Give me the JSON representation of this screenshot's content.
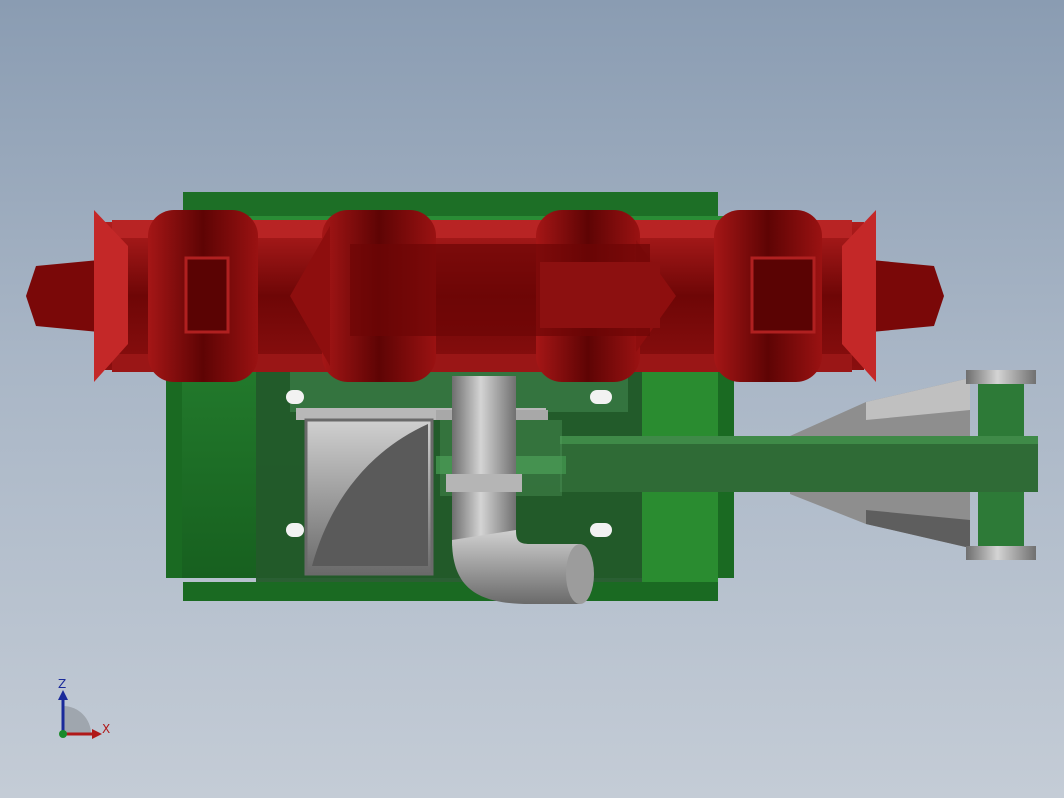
{
  "viewport": {
    "background_top": "#8a9cb2",
    "background_bottom": "#c4ccd6"
  },
  "model": {
    "parts": [
      {
        "name": "frame",
        "color": "#1f7a2a"
      },
      {
        "name": "roller-chain",
        "color": "#7a0a0a"
      },
      {
        "name": "hopper",
        "color": "#9a9a9a"
      },
      {
        "name": "elbow-pipe",
        "color": "#a0a0a0"
      },
      {
        "name": "support-arm",
        "color": "#2f6b36"
      },
      {
        "name": "bracket",
        "color": "#8c8c8c"
      }
    ]
  },
  "triad": {
    "z_label": "Z",
    "x_label": "X",
    "z_color": "#1a2a9a",
    "x_color": "#b01818",
    "y_color": "#1a8a2a"
  }
}
